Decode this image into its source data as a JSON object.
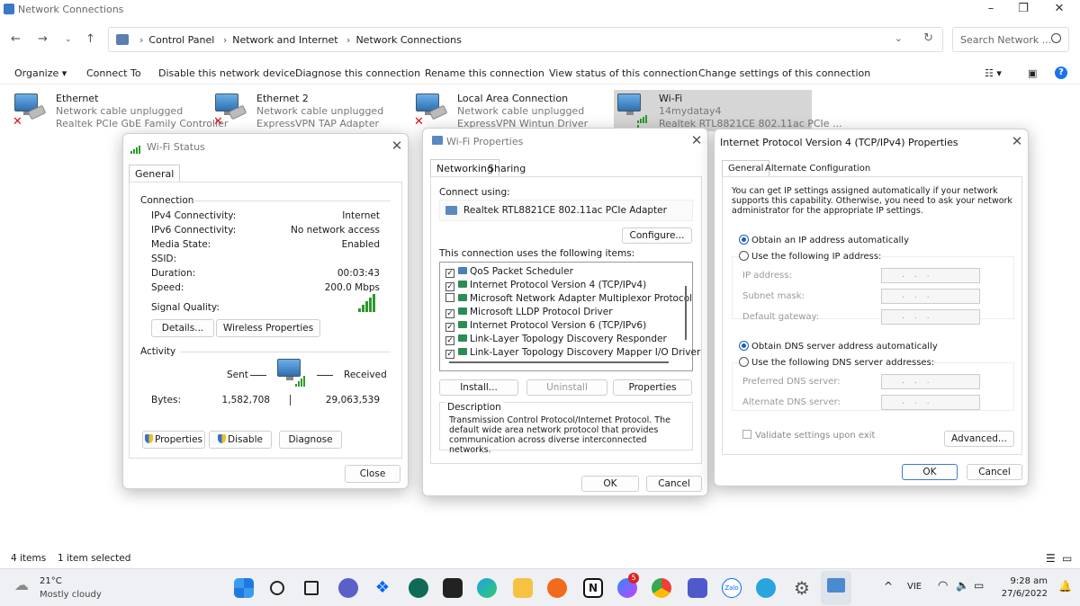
{
  "window": {
    "title": "Network Connections"
  },
  "address": {
    "segments": [
      "Control Panel",
      "Network and Internet",
      "Network Connections"
    ],
    "search_placeholder": "Search Network ..."
  },
  "commands": {
    "organize": "Organize",
    "connect_to": "Connect To",
    "disable": "Disable this network device",
    "diagnose": "Diagnose this connection",
    "rename": "Rename this connection",
    "view_status": "View status of this connection",
    "change_settings": "Change settings of this connection"
  },
  "adapters": [
    {
      "name": "Ethernet",
      "status": "Network cable unplugged",
      "device": "Realtek PCIe GbE Family Controller"
    },
    {
      "name": "Ethernet 2",
      "status": "Network cable unplugged",
      "device": "ExpressVPN TAP Adapter"
    },
    {
      "name": "Local Area Connection",
      "status": "Network cable unplugged",
      "device": "ExpressVPN Wintun Driver"
    },
    {
      "name": "Wi-Fi",
      "status": "14mydatay4",
      "device": "Realtek RTL8821CE 802.11ac PCIe ..."
    }
  ],
  "wifi_status": {
    "title": "Wi-Fi Status",
    "tab": "General",
    "connection_header": "Connection",
    "rows": [
      {
        "label": "IPv4 Connectivity:",
        "value": "Internet"
      },
      {
        "label": "IPv6 Connectivity:",
        "value": "No network access"
      },
      {
        "label": "Media State:",
        "value": "Enabled"
      },
      {
        "label": "SSID:",
        "value": ""
      },
      {
        "label": "Duration:",
        "value": "00:03:43"
      },
      {
        "label": "Speed:",
        "value": "200.0 Mbps"
      }
    ],
    "signal_label": "Signal Quality:",
    "details_btn": "Details...",
    "wireless_btn": "Wireless Properties",
    "activity_header": "Activity",
    "sent_label": "Sent",
    "received_label": "Received",
    "bytes_label": "Bytes:",
    "bytes_sent": "1,582,708",
    "bytes_received": "29,063,539",
    "properties_btn": "Properties",
    "disable_btn": "Disable",
    "diagnose_btn": "Diagnose",
    "close_btn": "Close"
  },
  "wifi_props": {
    "title": "Wi-Fi Properties",
    "tab_networking": "Networking",
    "tab_sharing": "Sharing",
    "connect_using": "Connect using:",
    "adapter": "Realtek RTL8821CE 802.11ac PCIe Adapter",
    "configure_btn": "Configure...",
    "items_label": "This connection uses the following items:",
    "items": [
      {
        "checked": true,
        "label": "QoS Packet Scheduler"
      },
      {
        "checked": true,
        "label": "Internet Protocol Version 4 (TCP/IPv4)"
      },
      {
        "checked": false,
        "label": "Microsoft Network Adapter Multiplexor Protocol"
      },
      {
        "checked": true,
        "label": "Microsoft LLDP Protocol Driver"
      },
      {
        "checked": true,
        "label": "Internet Protocol Version 6 (TCP/IPv6)"
      },
      {
        "checked": true,
        "label": "Link-Layer Topology Discovery Responder"
      },
      {
        "checked": true,
        "label": "Link-Layer Topology Discovery Mapper I/O Driver"
      }
    ],
    "install_btn": "Install...",
    "uninstall_btn": "Uninstall",
    "properties_btn": "Properties",
    "description_header": "Description",
    "description": "Transmission Control Protocol/Internet Protocol. The default wide area network protocol that provides communication across diverse interconnected networks.",
    "ok_btn": "OK",
    "cancel_btn": "Cancel"
  },
  "ipv4": {
    "title": "Internet Protocol Version 4 (TCP/IPv4) Properties",
    "tab_general": "General",
    "tab_alternate": "Alternate Configuration",
    "intro": "You can get IP settings assigned automatically if your network supports this capability. Otherwise, you need to ask your network administrator for the appropriate IP settings.",
    "obtain_ip": "Obtain an IP address automatically",
    "use_ip": "Use the following IP address:",
    "ip_label": "IP address:",
    "subnet_label": "Subnet mask:",
    "gateway_label": "Default gateway:",
    "obtain_dns": "Obtain DNS server address automatically",
    "use_dns": "Use the following DNS server addresses:",
    "preferred_dns": "Preferred DNS server:",
    "alternate_dns": "Alternate DNS server:",
    "validate": "Validate settings upon exit",
    "advanced_btn": "Advanced...",
    "ok_btn": "OK",
    "cancel_btn": "Cancel"
  },
  "statusbar": {
    "items": "4 items",
    "selected": "1 item selected"
  },
  "taskbar": {
    "weather_temp": "21°C",
    "weather_desc": "Mostly cloudy",
    "lang": "VIE",
    "time": "9:28 am",
    "date": "27/6/2022",
    "messenger_badge": "5",
    "zalo_label": "Zalo"
  }
}
